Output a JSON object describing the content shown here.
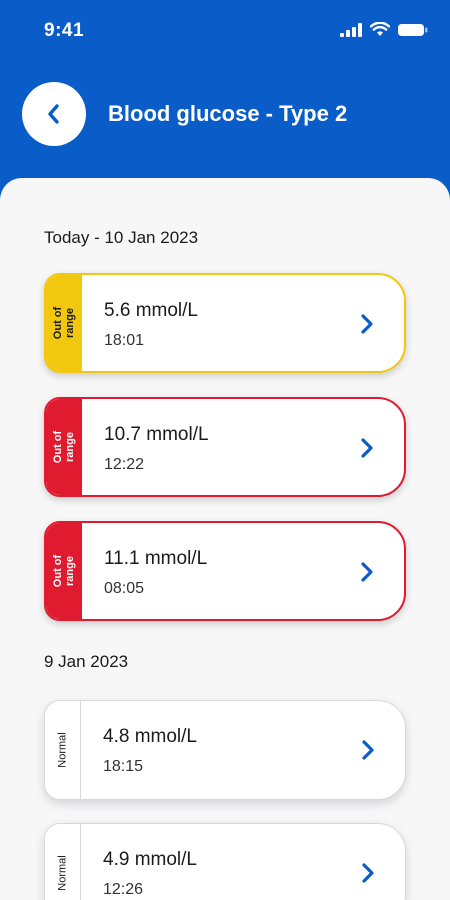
{
  "status_bar": {
    "time": "9:41",
    "icons": [
      "signal-icon",
      "wifi-icon",
      "battery-icon"
    ]
  },
  "header": {
    "title": "Blood glucose - Type 2",
    "back_icon": "chevron-left-icon"
  },
  "colors": {
    "brand_blue": "#0a5cc8",
    "out_of_range_yellow": "#f2c80f",
    "out_of_range_red": "#e01b2f"
  },
  "sections": [
    {
      "label": "Today - 10 Jan 2023",
      "readings": [
        {
          "status": "Out of\nrange",
          "severity": "yellow",
          "value": "5.6 mmol/L",
          "time": "18:01"
        },
        {
          "status": "Out of\nrange",
          "severity": "red",
          "value": "10.7 mmol/L",
          "time": "12:22"
        },
        {
          "status": "Out of\nrange",
          "severity": "red",
          "value": "11.1 mmol/L",
          "time": "08:05"
        }
      ]
    },
    {
      "label": "9 Jan 2023",
      "readings": [
        {
          "status": "Normal",
          "severity": "normal",
          "value": "4.8 mmol/L",
          "time": "18:15"
        },
        {
          "status": "Normal",
          "severity": "normal",
          "value": "4.9 mmol/L",
          "time": "12:26"
        }
      ]
    }
  ]
}
